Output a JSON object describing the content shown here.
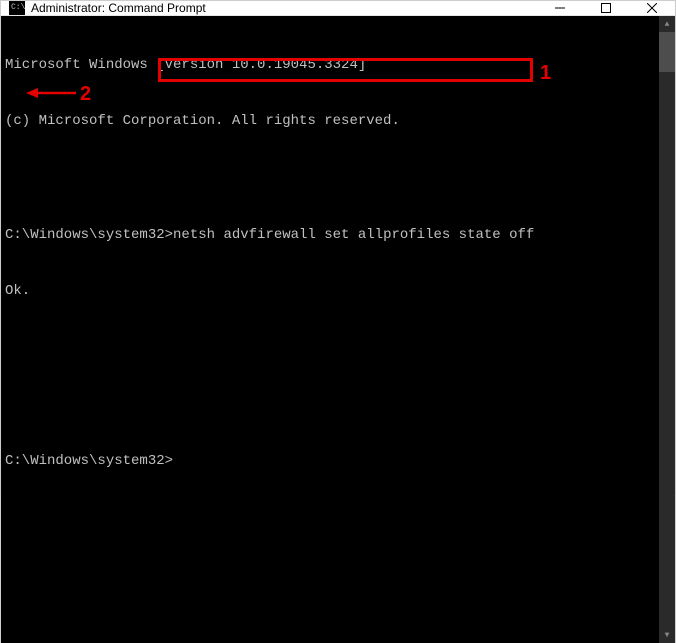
{
  "titlebar": {
    "title": "Administrator: Command Prompt"
  },
  "terminal": {
    "line1": "Microsoft Windows [Version 10.0.19045.3324]",
    "line2": "(c) Microsoft Corporation. All rights reserved.",
    "blank1": " ",
    "prompt1_prefix": "C:\\Windows\\system32>",
    "prompt1_command": "netsh advfirewall set allprofiles state off",
    "response1": "Ok.",
    "blank2": " ",
    "blank3": " ",
    "prompt2_prefix": "C:\\Windows\\system32>",
    "prompt2_command": ""
  },
  "annotations": {
    "label1": "1",
    "label2": "2"
  }
}
